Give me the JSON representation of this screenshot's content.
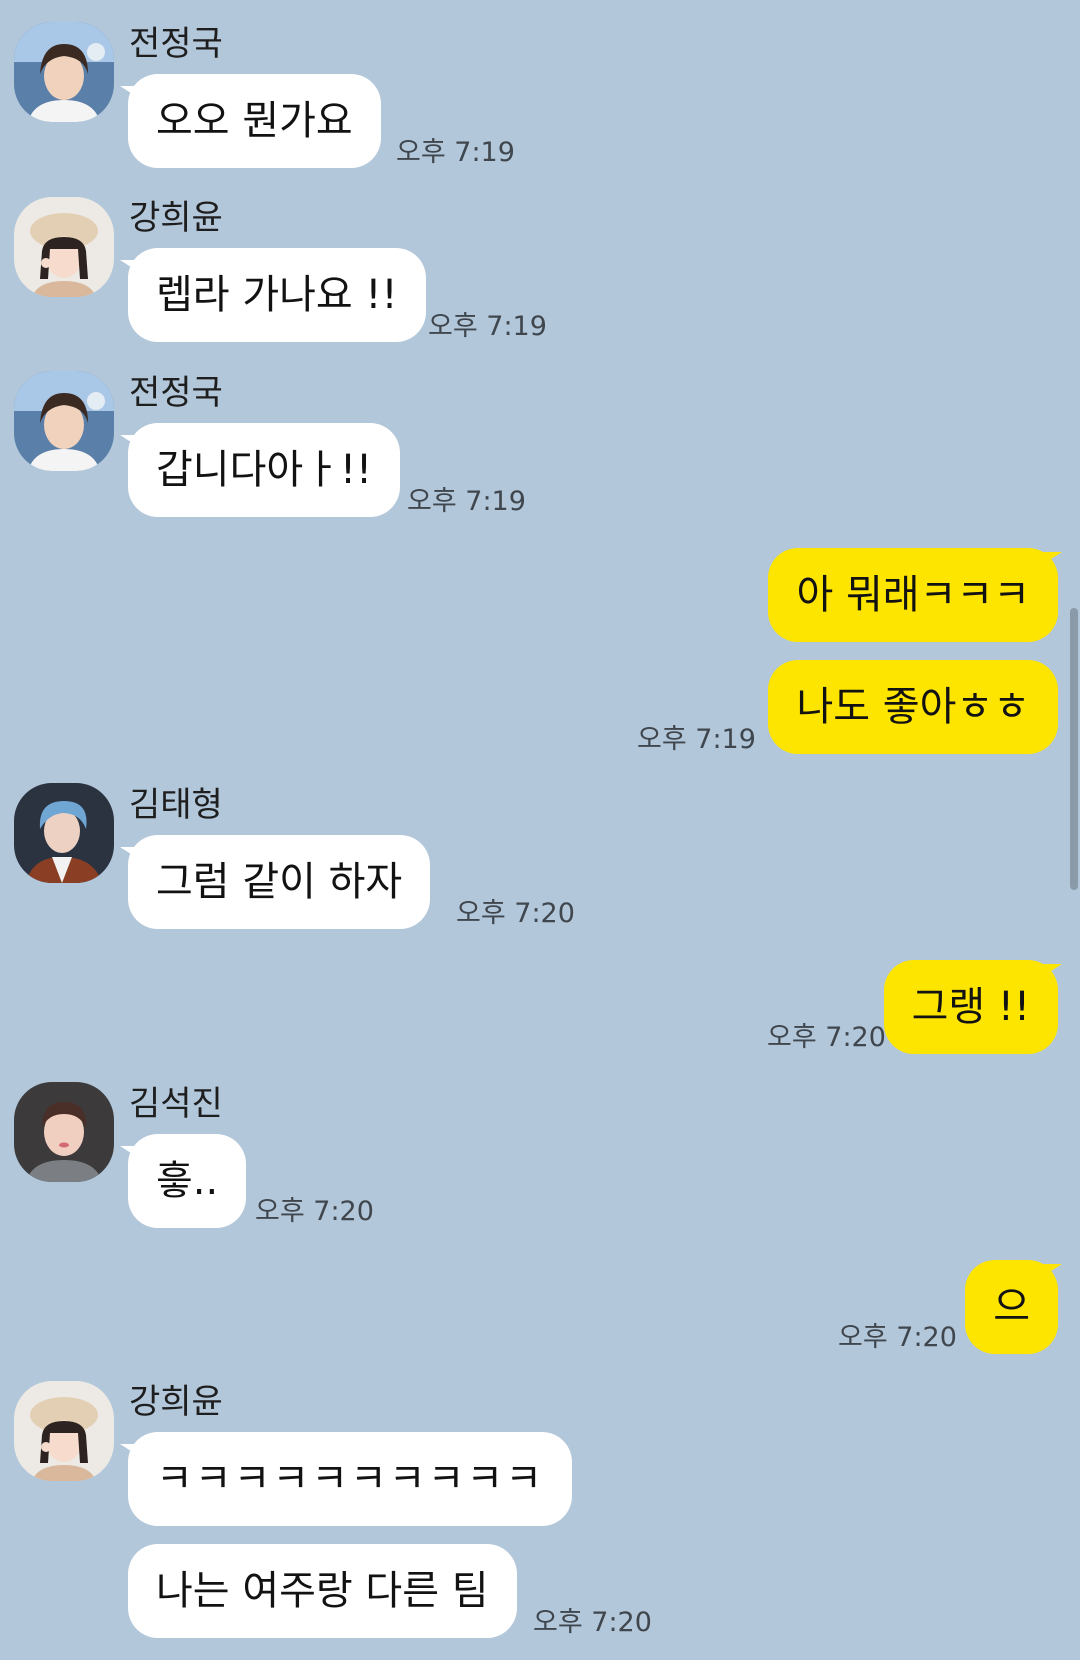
{
  "messages": [
    {
      "sender": "전정국",
      "text": "오오 뭔가요",
      "time": "오후 7:19"
    },
    {
      "sender": "강희윤",
      "text": "렙라 가나요 !!",
      "time": "오후 7:19"
    },
    {
      "sender": "전정국",
      "text": "갑니다아ㅏ!!",
      "time": "오후 7:19"
    },
    {
      "text": "아 뭐래ㅋㅋㅋ"
    },
    {
      "text": "나도 좋아ㅎㅎ",
      "time": "오후 7:19"
    },
    {
      "sender": "김태형",
      "text": "그럼 같이 하자",
      "time": "오후 7:20"
    },
    {
      "text": "그랭 !!",
      "time": "오후 7:20"
    },
    {
      "sender": "김석진",
      "text": "흫..",
      "time": "오후 7:20"
    },
    {
      "text": "으",
      "time": "오후 7:20"
    },
    {
      "sender": "강희윤",
      "text": "ㅋㅋㅋㅋㅋㅋㅋㅋㅋㅋ"
    },
    {
      "text": "나는 여주랑 다른 팀",
      "time": "오후 7:20"
    }
  ],
  "colors": {
    "background": "#b2c7da",
    "incoming_bubble": "#ffffff",
    "outgoing_bubble": "#fee500"
  }
}
